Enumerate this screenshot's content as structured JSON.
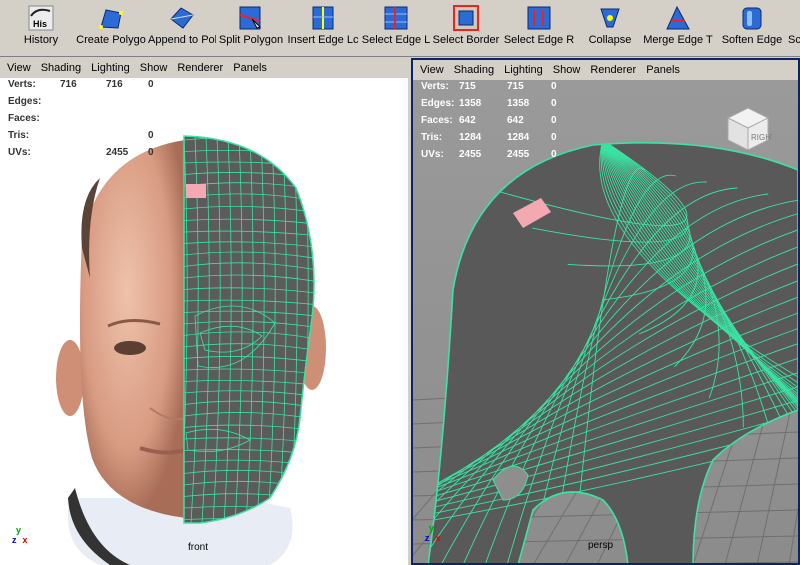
{
  "shelf": {
    "buttons": [
      {
        "label": "History",
        "icon_text": "His"
      },
      {
        "label": "Create Polygo"
      },
      {
        "label": "Append to Pol"
      },
      {
        "label": "Split Polygon"
      },
      {
        "label": "Insert Edge Lc"
      },
      {
        "label": "Select Edge L"
      },
      {
        "label": "Select Border"
      },
      {
        "label": "Select Edge R"
      },
      {
        "label": "Collapse"
      },
      {
        "label": "Merge Edge T"
      },
      {
        "label": "Soften Edge"
      },
      {
        "label": "Sc"
      }
    ]
  },
  "panels": [
    {
      "menu": [
        "View",
        "Shading",
        "Lighting",
        "Show",
        "Renderer",
        "Panels"
      ],
      "camera": "front",
      "hud": [
        {
          "label": "Verts:",
          "v1": "716",
          "v2": "716",
          "v3": "0"
        },
        {
          "label": "Edges:",
          "v1": "",
          "v2": "",
          "v3": ""
        },
        {
          "label": "Faces:",
          "v1": "",
          "v2": "",
          "v3": ""
        },
        {
          "label": "Tris:",
          "v1": "",
          "v2": "",
          "v3": "0"
        },
        {
          "label": "UVs:",
          "v1": "2455",
          "v2": "",
          "v3": "0"
        }
      ]
    },
    {
      "menu": [
        "View",
        "Shading",
        "Lighting",
        "Show",
        "Renderer",
        "Panels"
      ],
      "camera": "persp",
      "cube_face": "RIGHT",
      "hud": [
        {
          "label": "Verts:",
          "v1": "715",
          "v2": "715",
          "v3": "0"
        },
        {
          "label": "Edges:",
          "v1": "1358",
          "v2": "1358",
          "v3": "0"
        },
        {
          "label": "Faces:",
          "v1": "642",
          "v2": "642",
          "v3": "0"
        },
        {
          "label": "Tris:",
          "v1": "1284",
          "v2": "1284",
          "v3": "0"
        },
        {
          "label": "UVs:",
          "v1": "2455",
          "v2": "2455",
          "v3": "0"
        }
      ]
    }
  ],
  "axis": {
    "y": "y",
    "z": "z",
    "x": "x"
  },
  "colors": {
    "wire": "#3be3a2",
    "axis_y": "#00a000",
    "axis_x": "#d00000",
    "axis_z": "#0000c0",
    "highlight": "#f4a9b1",
    "active_border": "#0a246a"
  }
}
